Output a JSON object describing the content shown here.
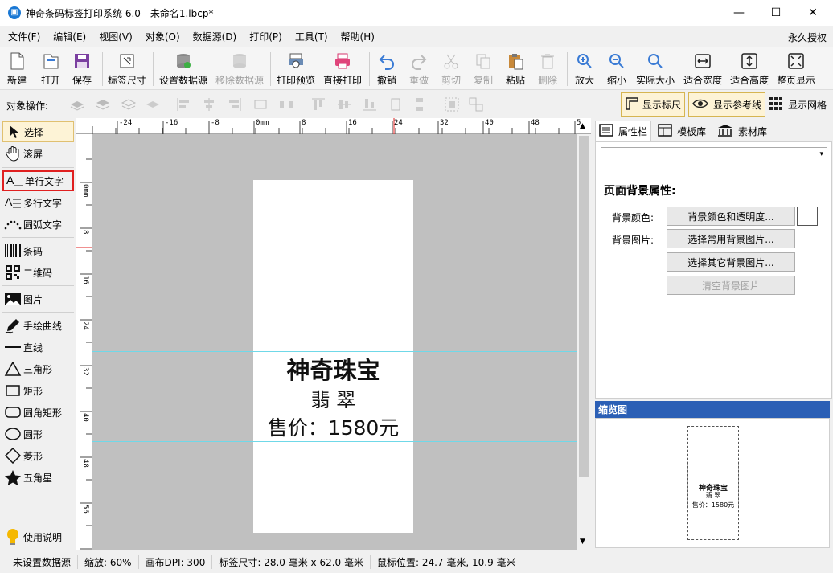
{
  "window": {
    "title": "神奇条码标签打印系统 6.0 - 未命名1.lbcp*",
    "minimize": "—",
    "maximize": "☐",
    "close": "✕"
  },
  "menu": {
    "items": [
      "文件(F)",
      "编辑(E)",
      "视图(V)",
      "对象(O)",
      "数据源(D)",
      "打印(P)",
      "工具(T)",
      "帮助(H)"
    ],
    "license": "永久授权"
  },
  "toolbar": {
    "new": "新建",
    "open": "打开",
    "save": "保存",
    "label_size": "标签尺寸",
    "set_datasource": "设置数据源",
    "remove_datasource": "移除数据源",
    "print_preview": "打印预览",
    "direct_print": "直接打印",
    "undo": "撤销",
    "redo": "重做",
    "cut": "剪切",
    "copy": "复制",
    "paste": "粘贴",
    "delete": "删除",
    "zoom_in": "放大",
    "zoom_out": "缩小",
    "actual_size": "实际大小",
    "fit_width": "适合宽度",
    "fit_height": "适合高度",
    "fit_page": "整页显示"
  },
  "objbar": {
    "label": "对象操作:",
    "show_ruler": "显示标尺",
    "show_guides": "显示参考线",
    "show_grid": "显示网格"
  },
  "tools": {
    "select": "选择",
    "scroll": "滚屏",
    "single_text": "单行文字",
    "multi_text": "多行文字",
    "arc_text": "圆弧文字",
    "barcode": "条码",
    "qrcode": "二维码",
    "image": "图片",
    "freehand": "手绘曲线",
    "line": "直线",
    "triangle": "三角形",
    "rectangle": "矩形",
    "round_rect": "圆角矩形",
    "ellipse": "圆形",
    "diamond": "菱形",
    "star": "五角星",
    "help": "使用说明"
  },
  "ruler": {
    "top": [
      "-24",
      "-16",
      "-8",
      "0mm",
      "8",
      "16",
      "24",
      "32",
      "40",
      "48",
      "5"
    ],
    "left": [
      "0mm",
      "8",
      "16",
      "24",
      "32",
      "40",
      "48",
      "56"
    ]
  },
  "label": {
    "line1": "神奇珠宝",
    "line2": "翡  翠",
    "line3": "售价：1580元"
  },
  "right_panel": {
    "tabs": [
      "属性栏",
      "模板库",
      "素材库"
    ],
    "heading": "页面背景属性:",
    "bg_color_label": "背景颜色:",
    "bg_color_btn": "背景颜色和透明度...",
    "bg_image_label": "背景图片:",
    "bg_common_btn": "选择常用背景图片...",
    "bg_other_btn": "选择其它背景图片...",
    "bg_clear_btn": "清空背景图片",
    "thumb_header": "缩览图"
  },
  "status": {
    "datasource": "未设置数据源",
    "zoom": "缩放: 60%",
    "dpi": "画布DPI: 300",
    "label_size": "标签尺寸: 28.0 毫米 x 62.0 毫米",
    "mouse_pos": "鼠标位置: 24.7 毫米, 10.9 毫米"
  }
}
